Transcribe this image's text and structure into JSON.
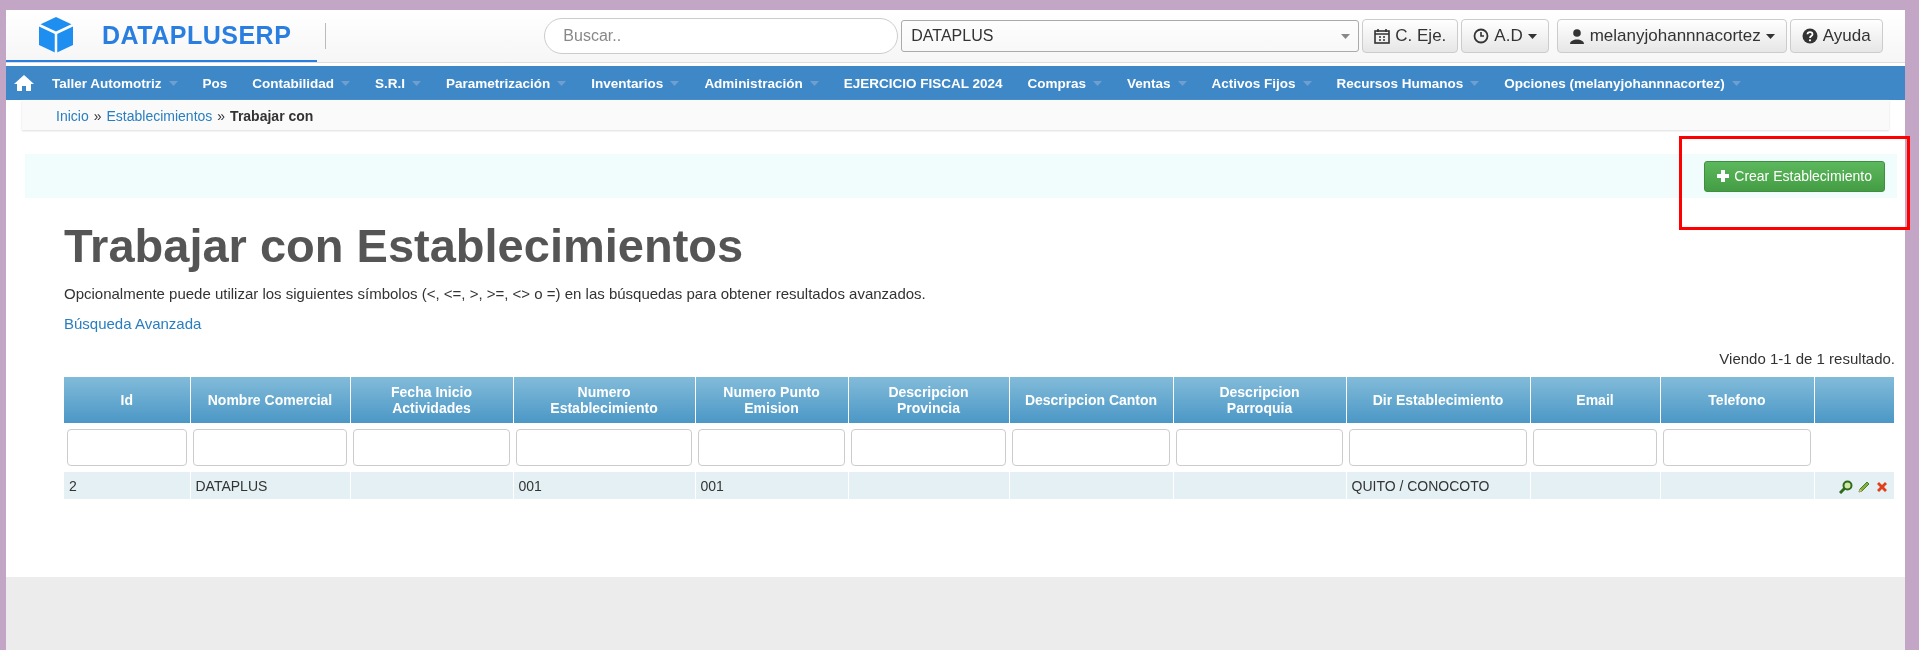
{
  "brand": {
    "name": "DATAPLUSERP"
  },
  "search": {
    "placeholder": "Buscar.."
  },
  "company_select": {
    "value": "DATAPLUS"
  },
  "toolbar_buttons": [
    {
      "kind": "calendar",
      "label": "C. Eje.",
      "dropdown": false
    },
    {
      "kind": "clock",
      "label": "A.D",
      "dropdown": true
    },
    {
      "kind": "user",
      "label": "melanyjohannnacortez",
      "dropdown": true
    },
    {
      "kind": "help",
      "label": "Ayuda",
      "dropdown": false
    }
  ],
  "nav": [
    {
      "label": "Taller Automotriz",
      "dropdown": true
    },
    {
      "label": "Pos",
      "dropdown": false
    },
    {
      "label": "Contabilidad",
      "dropdown": true
    },
    {
      "label": "S.R.I",
      "dropdown": true
    },
    {
      "label": "Parametrización",
      "dropdown": true
    },
    {
      "label": "Inventarios",
      "dropdown": true
    },
    {
      "label": "Administración",
      "dropdown": true
    },
    {
      "label": "EJERCICIO FISCAL 2024",
      "dropdown": false
    },
    {
      "label": "Compras",
      "dropdown": true
    },
    {
      "label": "Ventas",
      "dropdown": true
    },
    {
      "label": "Activos Fijos",
      "dropdown": true
    },
    {
      "label": "Recursos Humanos",
      "dropdown": true
    },
    {
      "label": "Opciones (melanyjohannnacortez)",
      "dropdown": true
    }
  ],
  "breadcrumb": {
    "links": [
      "Inicio",
      "Establecimientos"
    ],
    "separator": "»",
    "current": "Trabajar con"
  },
  "create_button": {
    "label": "Crear Establecimiento"
  },
  "page": {
    "title": "Trabajar con Establecimientos",
    "hint": "Opcionalmente puede utilizar los siguientes símbolos (<, <=, >, >=, <> o =) en las búsquedas para obtener resultados avanzados.",
    "advanced_search": "Búsqueda Avanzada",
    "summary": "Viendo 1-1 de 1 resultado."
  },
  "table": {
    "columns": [
      "Id",
      "Nombre Comercial",
      "Fecha Inicio Actividades",
      "Numero Establecimiento",
      "Numero Punto Emision",
      "Descripcion Provincia",
      "Descripcion Canton",
      "Descripcion Parroquia",
      "Dir Establecimiento",
      "Email",
      "Telefono"
    ],
    "rows": [
      {
        "cells": [
          "2",
          "DATAPLUS",
          "",
          "001",
          "001",
          "",
          "",
          "",
          "QUITO / CONOCOTO",
          "",
          ""
        ]
      }
    ]
  }
}
